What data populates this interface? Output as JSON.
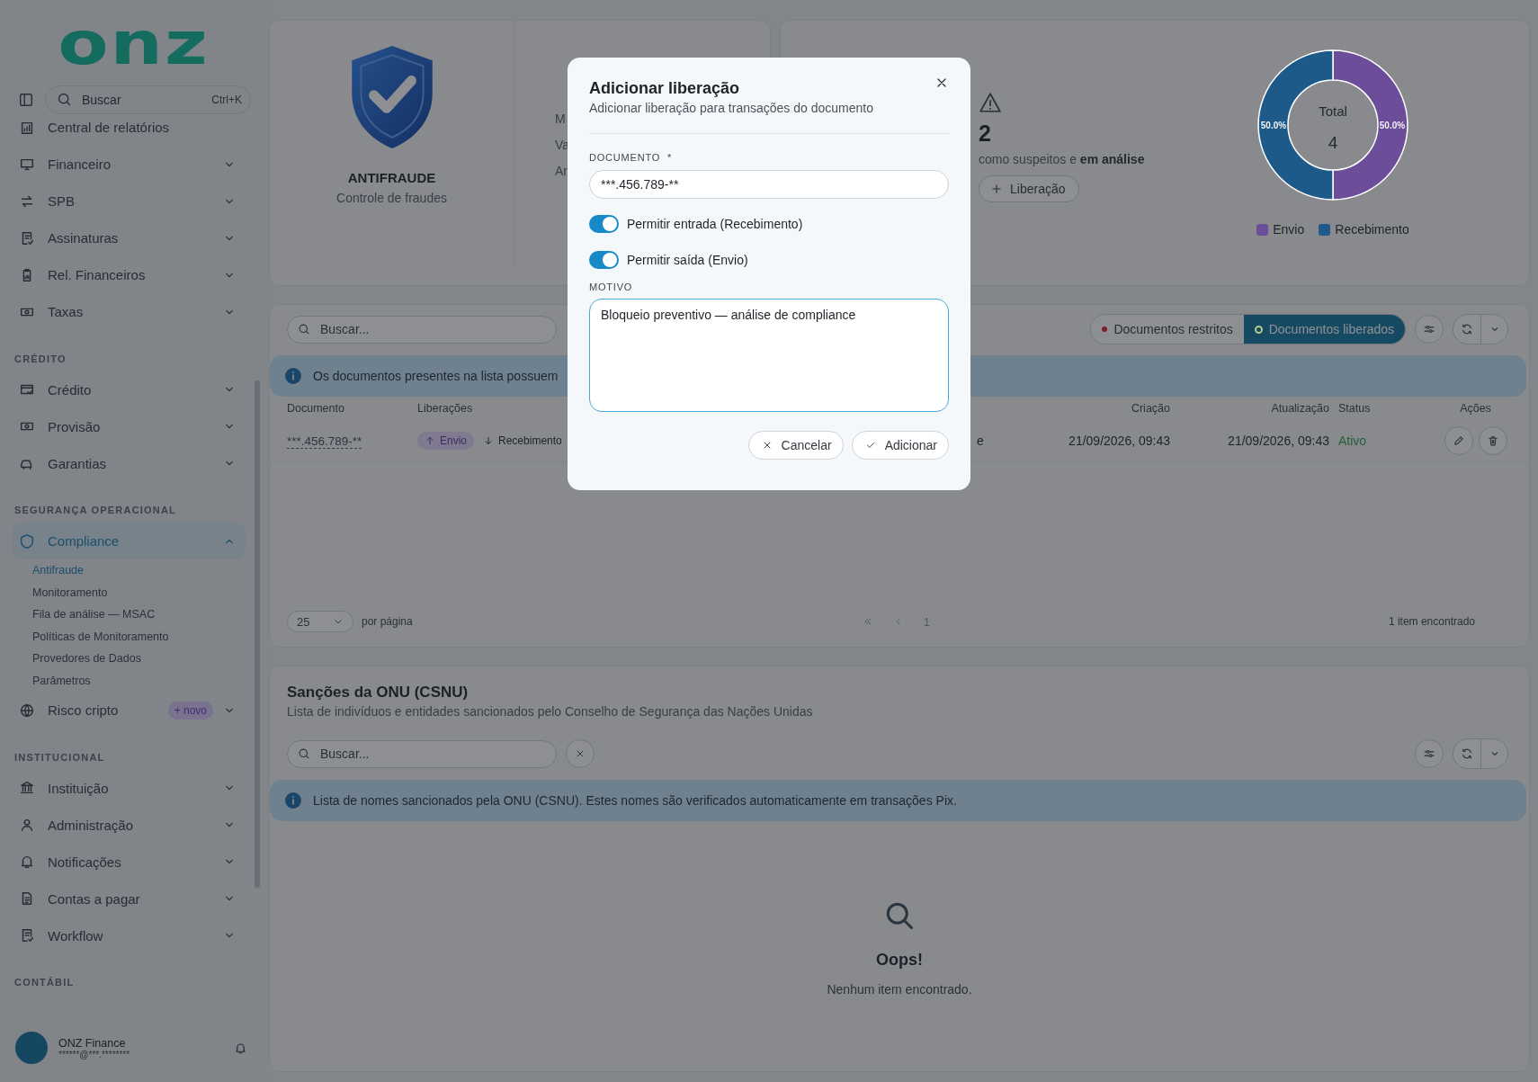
{
  "sidebar": {
    "logo": "onz",
    "search": {
      "placeholder": "Buscar",
      "shortcut": "Ctrl+K"
    },
    "sections": [
      {
        "items": [
          {
            "label": "Central de relatórios",
            "selected": false
          },
          {
            "label": "Financeiro",
            "selected": false,
            "expanded": false
          },
          {
            "label": "SPB",
            "selected": false,
            "expanded": false
          },
          {
            "label": "Assinaturas",
            "selected": false,
            "expanded": false
          },
          {
            "label": "Rel. Financeiros",
            "selected": false,
            "expanded": false
          },
          {
            "label": "Taxas",
            "selected": false,
            "expanded": false
          }
        ]
      },
      {
        "heading": "CRÉDITO",
        "items": [
          {
            "label": "Crédito",
            "selected": false,
            "expanded": false
          },
          {
            "label": "Provisão",
            "selected": false,
            "expanded": false
          },
          {
            "label": "Garantias",
            "selected": false,
            "expanded": false
          }
        ]
      },
      {
        "heading": "SEGURANÇA OPERACIONAL",
        "items": [
          {
            "label": "Compliance",
            "selected": true,
            "expanded": true,
            "children": [
              {
                "label": "Antifraude",
                "selected": true
              },
              {
                "label": "Monitoramento",
                "selected": false
              },
              {
                "label": "Fila de análise — MSAC",
                "selected": false
              },
              {
                "label": "Políticas de Monitoramento",
                "selected": false
              },
              {
                "label": "Provedores de Dados",
                "selected": false
              },
              {
                "label": "Parâmetros",
                "selected": false
              }
            ]
          },
          {
            "label": "Risco cripto",
            "selected": false,
            "expanded": false,
            "badge": "+ novo"
          }
        ]
      },
      {
        "heading": "INSTITUCIONAL",
        "items": [
          {
            "label": "Instituição",
            "selected": false,
            "expanded": false
          },
          {
            "label": "Administração",
            "selected": false,
            "expanded": false
          },
          {
            "label": "Notificações",
            "selected": false,
            "expanded": false
          },
          {
            "label": "Contas a pagar",
            "selected": false,
            "expanded": false
          },
          {
            "label": "Workflow",
            "selected": false,
            "expanded": false
          }
        ]
      },
      {
        "heading": "CONTÁBIL"
      }
    ],
    "user": {
      "name": "ONZ Finance",
      "email": "******@***.********"
    }
  },
  "summary": {
    "title": "ANTIFRAUDE",
    "subtitle": "Controle de fraudes",
    "stat_labels": [
      "M",
      "Va",
      "An"
    ]
  },
  "suspects": {
    "value": "2",
    "text": "como suspeitos e **em análise**",
    "button": "Liberação"
  },
  "chart": {
    "center_label": "Total",
    "center_value": "4",
    "legend": [
      {
        "color": "#6b4d99"
      },
      {
        "color": "#1d5a8a"
      }
    ],
    "chart_data": {
      "type": "donut",
      "categories": [
        "Envio",
        "Recebimento"
      ],
      "values": [
        50,
        50
      ],
      "value_labels": [
        "50.0%",
        "50.0%"
      ]
    }
  },
  "documents": {
    "search": {
      "placeholder": "Buscar..."
    },
    "filters": [
      {
        "label": "Documentos restritos",
        "selected": false,
        "color": "#7a1f24"
      },
      {
        "label": "Documentos liberados",
        "selected": true,
        "color": "#b3cc8a"
      }
    ],
    "banner": "Os documentos presentes na lista possuem",
    "columns": [
      "Documento",
      "Liberações",
      "Criação",
      "Atualização",
      "Status",
      "Ações"
    ],
    "rows": [
      {
        "document": "***.456.789-**",
        "releases": [
          {
            "label": "Envio",
            "kind": "outgoing"
          },
          {
            "label": "Recebimento",
            "kind": "incoming"
          }
        ],
        "column_3": "e",
        "created": "21/09/2026, 09:43",
        "updated": "21/09/2026, 09:43",
        "status": "Ativo"
      }
    ],
    "pagination": {
      "page_size": "25",
      "per_page": "por página",
      "page": "1",
      "count": "1 item encontrado"
    }
  },
  "sanctions": {
    "title": "Sanções da ONU (CSNU)",
    "subtitle": "Lista de indivíduos e entidades sancionados pelo Conselho de Segurança das Nações Unidas",
    "search": {
      "placeholder": "Buscar..."
    },
    "banner": "Lista de nomes sancionados pela ONU (CSNU). Estes nomes são verificados automaticamente em transações Pix.",
    "empty_title": "Oops!",
    "empty_text": "Nenhum item encontrado."
  },
  "modal": {
    "title": "Adicionar liberação",
    "subtitle": "Adicionar liberação para transações do documento",
    "document": {
      "label": "DOCUMENTO",
      "required": "*",
      "value": "***.456.789-**"
    },
    "toggles": [
      {
        "label": "Permitir entrada (Recebimento)",
        "on": true
      },
      {
        "label": "Permitir saída (Envio)",
        "on": true
      }
    ],
    "reason": {
      "label": "MOTIVO",
      "value": "Bloqueio preventivo — análise de compliance"
    },
    "buttons": [
      {
        "label": "Cancelar",
        "kind": "cancel"
      },
      {
        "label": "Adicionar",
        "kind": "confirm"
      }
    ]
  }
}
